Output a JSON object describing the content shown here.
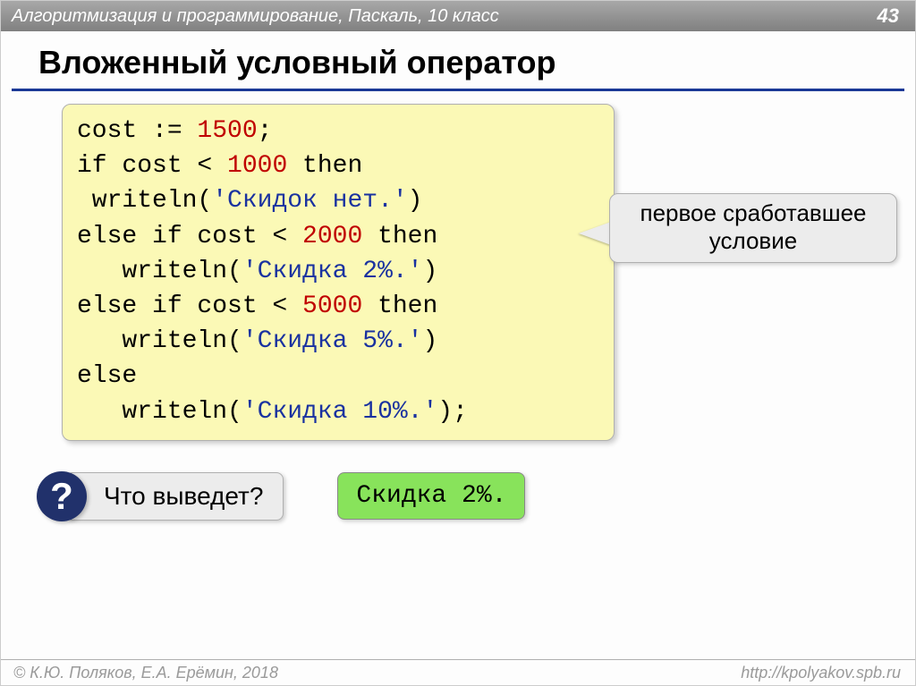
{
  "header": {
    "breadcrumb": "Алгоритмизация и программирование, Паскаль, 10 класс",
    "page": "43"
  },
  "title": "Вложенный условный оператор",
  "code": {
    "l1a": "cost := ",
    "l1b": "1500",
    "l1c": ";",
    "l2a": "if cost < ",
    "l2b": "1000",
    "l2c": " then",
    "l3a": " writeln(",
    "l3b": "'Скидок нет.'",
    "l3c": ")",
    "l4a": "else if cost < ",
    "l4b": "2000",
    "l4c": " then",
    "l5a": "   writeln(",
    "l5b": "'Скидка 2%.'",
    "l5c": ")",
    "l6a": "else if cost < ",
    "l6b": "5000",
    "l6c": " then",
    "l7a": "   writeln(",
    "l7b": "'Скидка 5%.'",
    "l7c": ")",
    "l8": "else",
    "l9a": "   writeln(",
    "l9b": "'Скидка 10%.'",
    "l9c": ");"
  },
  "callout": {
    "line1": "первое сработавшее",
    "line2": "условие"
  },
  "question": {
    "mark": "?",
    "text": "Что выведет?",
    "answer": "Скидка 2%."
  },
  "footer": {
    "left": "© К.Ю. Поляков, Е.А. Ерёмин, 2018",
    "right": "http://kpolyakov.spb.ru"
  }
}
